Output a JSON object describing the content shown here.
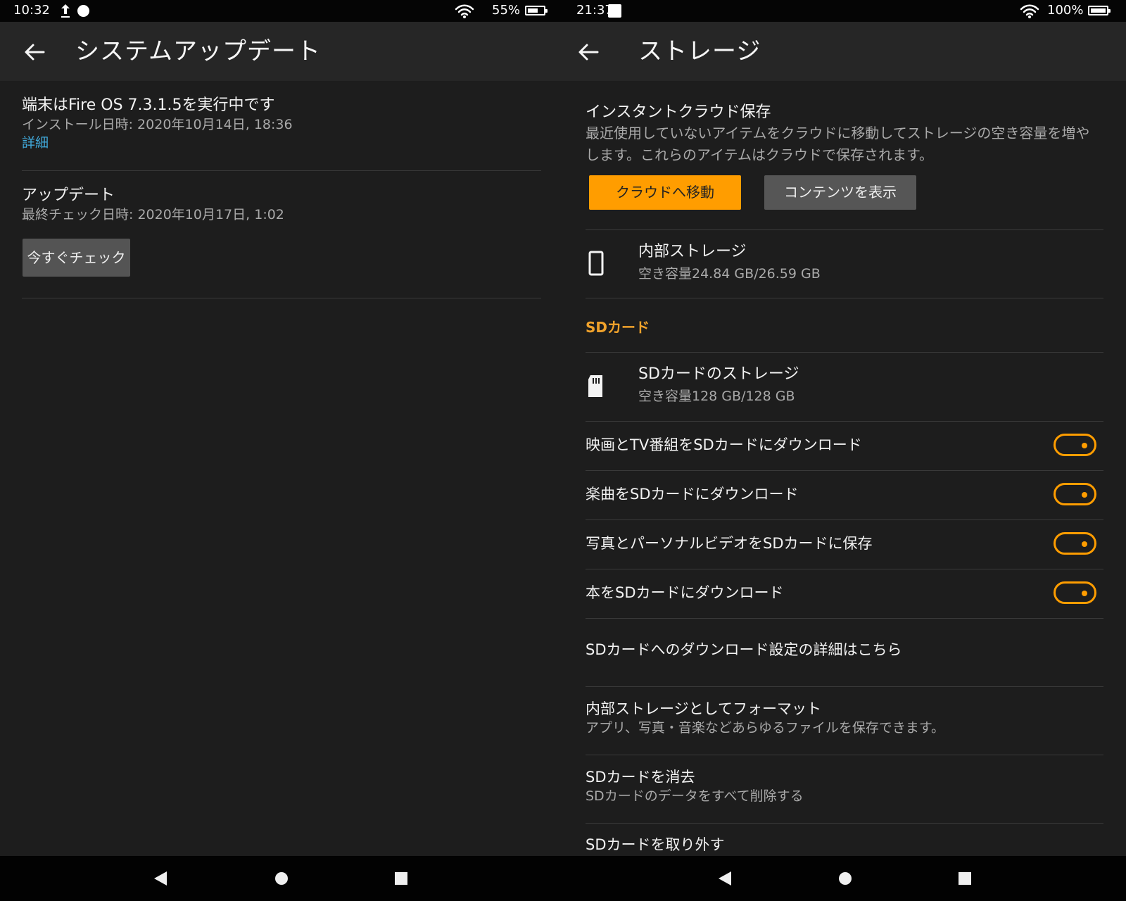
{
  "left": {
    "status": {
      "time": "10:32",
      "battery": "55%",
      "battery_level": 55,
      "icons": [
        "upload-icon",
        "notification-dot-icon",
        "wifi-icon",
        "battery-icon"
      ]
    },
    "header": {
      "title": "システムアップデート",
      "back_icon": "back-arrow-icon"
    },
    "system": {
      "running": "端末はFire OS 7.3.1.5を実行中です",
      "installed": "インストール日時: 2020年10月14日, 18:36",
      "details_link": "詳細"
    },
    "updates": {
      "title": "アップデート",
      "last_checked": "最終チェック日時: 2020年10月17日, 1:02",
      "check_button": "今すぐチェック"
    },
    "nav": {
      "icons": [
        "back-icon",
        "home-icon",
        "recent-apps-icon"
      ]
    }
  },
  "right": {
    "status": {
      "time": "21:37",
      "battery": "100%",
      "battery_level": 100,
      "icons": [
        "notification-square-icon",
        "wifi-icon",
        "battery-icon"
      ]
    },
    "header": {
      "title": "ストレージ",
      "back_icon": "back-arrow-icon"
    },
    "cloud": {
      "title": "インスタントクラウド保存",
      "description": "最近使用していないアイテムをクラウドに移動してストレージの空き容量を増やします。これらのアイテムはクラウドで保存されます。",
      "move_button": "クラウドへ移動",
      "show_button": "コンテンツを表示"
    },
    "internal_storage": {
      "title": "内部ストレージ",
      "free_space": "空き容量24.84 GB/26.59 GB",
      "icon": "phone-icon"
    },
    "sd_section": {
      "title": "SDカード"
    },
    "sd_storage": {
      "title": "SDカードのストレージ",
      "free_space": "空き容量128 GB/128 GB",
      "icon": "sd-card-icon"
    },
    "download_options": [
      {
        "label": "映画とTV番組をSDカードにダウンロード",
        "enabled": true
      },
      {
        "label": "楽曲をSDカードにダウンロード",
        "enabled": true
      },
      {
        "label": "写真とパーソナルビデオをSDカードに保存",
        "enabled": true
      },
      {
        "label": "本をSDカードにダウンロード",
        "enabled": true
      }
    ],
    "sd_download_details": "SDカードへのダウンロード設定の詳細はこちら",
    "format": {
      "title": "内部ストレージとしてフォーマット",
      "description": "アプリ、写真・音楽などあらゆるファイルを保存できます。"
    },
    "erase": {
      "title": "SDカードを消去",
      "description": "SDカードのデータをすべて削除する"
    },
    "remove": {
      "title": "SDカードを取り外す"
    },
    "nav": {
      "icons": [
        "back-icon",
        "home-icon",
        "recent-apps-icon"
      ]
    }
  },
  "colors": {
    "background": "#1d1d1d",
    "header": "#262626",
    "accent": "#ff9d00",
    "link": "#40a8d9",
    "secondary_text": "#a9a9a9"
  }
}
